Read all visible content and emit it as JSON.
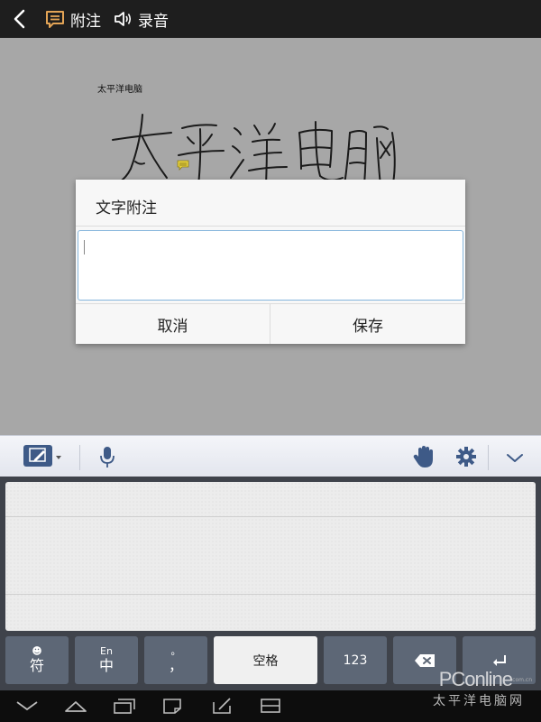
{
  "topbar": {
    "note_label": "附注",
    "record_label": "录音"
  },
  "canvas": {
    "small_text": "太平洋电脑"
  },
  "dialog": {
    "title": "文字附注",
    "input_value": "",
    "cancel_label": "取消",
    "save_label": "保存"
  },
  "keyboard": {
    "keys": {
      "symbol_top": "☻",
      "symbol_main": "符",
      "lang_top": "En",
      "lang_main": "中",
      "punct_top": "。",
      "punct_main": "，",
      "space": "空格",
      "num": "123"
    }
  },
  "watermark": {
    "brand": "PConline",
    "domain": "com.cn",
    "cn": "太平洋电脑网"
  },
  "colors": {
    "topbar_bg": "#1e1e1e",
    "canvas_bg": "#a7a7a7",
    "key_bg": "#5d6776",
    "accent": "#3e5a87",
    "input_border": "#86b6dc"
  }
}
